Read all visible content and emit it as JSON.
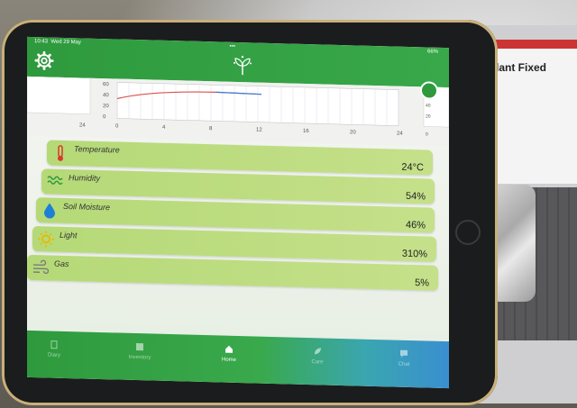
{
  "status_bar": {
    "time": "10:43",
    "date": "Wed 29 May",
    "dots": "•••",
    "battery": "66%"
  },
  "chart": {
    "left_y_ticks": [
      "60",
      "40",
      "20",
      "0"
    ],
    "left_partial_x": "24",
    "main_x_ticks": [
      "0",
      "4",
      "8",
      "12",
      "16",
      "20",
      "24"
    ],
    "right_y_ticks": [
      "60",
      "40",
      "20"
    ],
    "right_partial_x": "0"
  },
  "sensors": [
    {
      "label": "Temperature",
      "value": "24°C",
      "icon": "thermometer-icon",
      "icon_color": "#d9382b"
    },
    {
      "label": "Humidity",
      "value": "54%",
      "icon": "waves-icon",
      "icon_color": "#2e9a3d"
    },
    {
      "label": "Soil Moisture",
      "value": "46%",
      "icon": "droplet-icon",
      "icon_color": "#1d7fd6"
    },
    {
      "label": "Light",
      "value": "310%",
      "icon": "sun-icon",
      "icon_color": "#e8b800"
    },
    {
      "label": "Gas",
      "value": "5%",
      "icon": "wind-icon",
      "icon_color": "#7a7a7a"
    }
  ],
  "tabs": [
    {
      "label": "Diary",
      "icon": "document-icon",
      "active": false
    },
    {
      "label": "Inventory",
      "icon": "archive-icon",
      "active": false
    },
    {
      "label": "Home",
      "icon": "home-icon",
      "active": true
    },
    {
      "label": "Care",
      "icon": "leaf-icon",
      "active": false
    },
    {
      "label": "Chat",
      "icon": "chat-icon",
      "active": false
    }
  ],
  "laptop_screen_heading": "Plant Fixed",
  "colors": {
    "brand_green": "#2e9a3d",
    "card_green": "#b5d977",
    "chart_red": "#d9534f",
    "chart_blue": "#3b7dd8"
  }
}
